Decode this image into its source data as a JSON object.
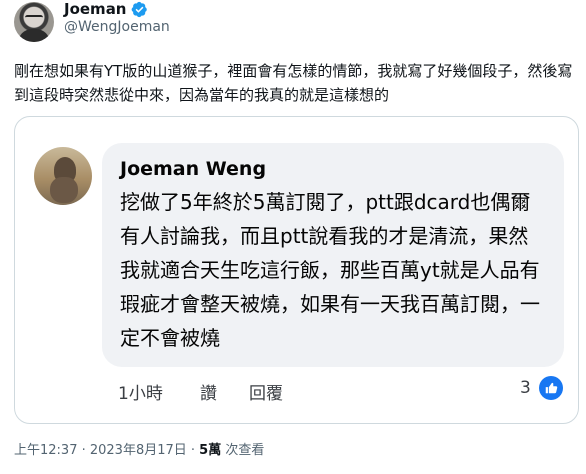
{
  "author": {
    "name": "Joeman",
    "handle": "@WengJoeman"
  },
  "tweet": {
    "text": "剛在想如果有YT版的山道猴子，裡面會有怎樣的情節，我就寫了好幾個段子，然後寫到這段時突然悲從中來，因為當年的我真的就是這樣想的"
  },
  "quote": {
    "commenter_name": "Joeman Weng",
    "comment": "挖做了5年終於5萬訂閱了，ptt跟dcard也偶爾有人討論我，而且ptt說看我的才是清流，果然我就適合天生吃這行飯，那些百萬yt就是人品有瑕疵才會整天被燒，如果有一天我百萬訂閱，一定不會被燒",
    "time": "1小時",
    "like_label": "讚",
    "reply_label": "回覆",
    "like_count": "3"
  },
  "meta": {
    "timestamp": "上午12:37 · 2023年8月17日 · ",
    "views_count": "5萬",
    "views_label": " 次查看"
  },
  "colors": {
    "verified_badge": "#1d9bf0",
    "facebook_blue": "#1877f2",
    "bubble_bg": "#f0f2f5"
  },
  "icons": [
    "verified-badge-icon",
    "thumbs-up-icon"
  ]
}
